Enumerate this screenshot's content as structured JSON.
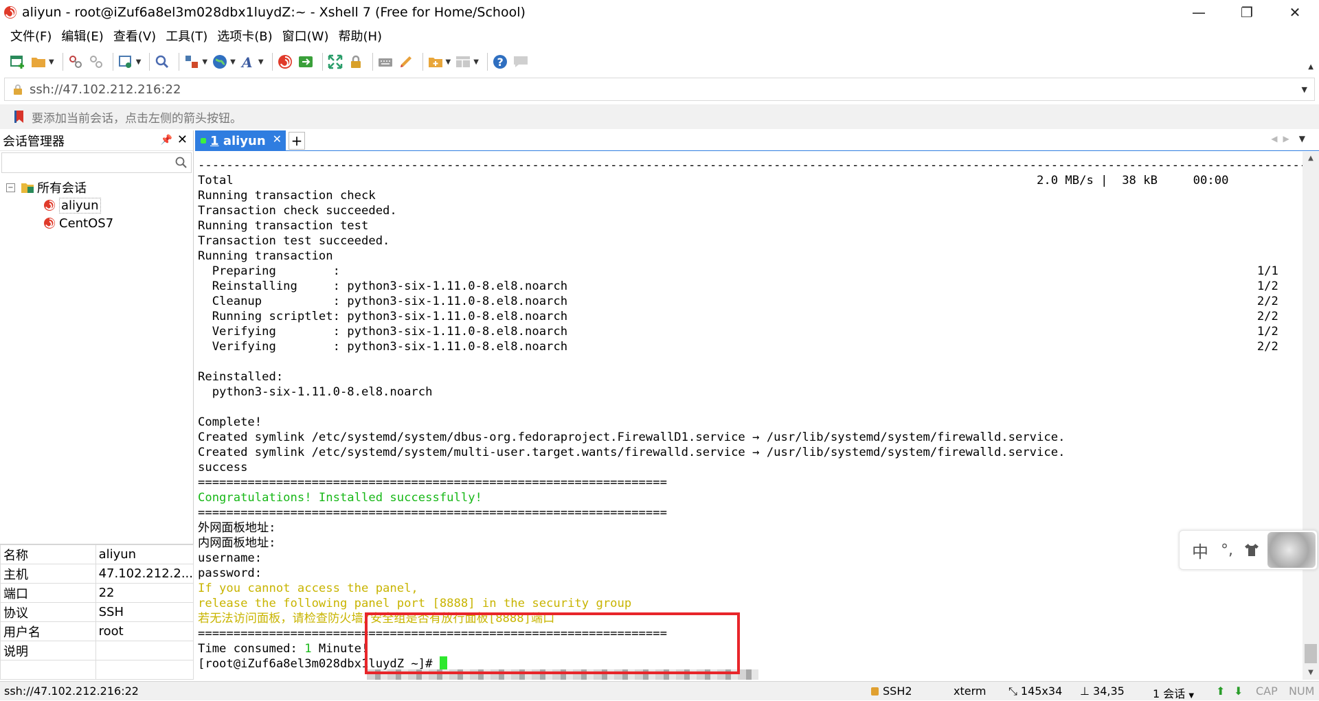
{
  "window": {
    "title": "aliyun - root@iZuf6a8el3m028dbx1luydZ:~ - Xshell 7 (Free for Home/School)",
    "controls": {
      "minimize": "—",
      "restore": "❐",
      "close": "✕"
    }
  },
  "menu": [
    "文件(F)",
    "编辑(E)",
    "查看(V)",
    "工具(T)",
    "选项卡(B)",
    "窗口(W)",
    "帮助(H)"
  ],
  "address": {
    "value": "ssh://47.102.212.216:22"
  },
  "hint": {
    "text": "要添加当前会话，点击左侧的箭头按钮。"
  },
  "session_manager": {
    "title": "会话管理器",
    "tree": {
      "root": "所有会话",
      "children": [
        "aliyun",
        "CentOS7"
      ]
    },
    "properties": [
      {
        "key": "名称",
        "value": "aliyun"
      },
      {
        "key": "主机",
        "value": "47.102.212.2..."
      },
      {
        "key": "端口",
        "value": "22"
      },
      {
        "key": "协议",
        "value": "SSH"
      },
      {
        "key": "用户名",
        "value": "root"
      },
      {
        "key": "说明",
        "value": ""
      },
      {
        "key": "",
        "value": ""
      }
    ]
  },
  "tabs": [
    {
      "num": "1",
      "label": "aliyun"
    }
  ],
  "terminal": {
    "lines": [
      {
        "t": "---------------------------------------------------------------------------------------------------------------------------------------------------------------------"
      },
      {
        "t": "Total                                                                                                                 2.0 MB/s |  38 kB     00:00"
      },
      {
        "t": "Running transaction check"
      },
      {
        "t": "Transaction check succeeded."
      },
      {
        "t": "Running transaction test"
      },
      {
        "t": "Transaction test succeeded."
      },
      {
        "t": "Running transaction"
      },
      {
        "t": "  Preparing        :                                                                                                                                 1/1"
      },
      {
        "t": "  Reinstalling     : python3-six-1.11.0-8.el8.noarch                                                                                                 1/2"
      },
      {
        "t": "  Cleanup          : python3-six-1.11.0-8.el8.noarch                                                                                                 2/2"
      },
      {
        "t": "  Running scriptlet: python3-six-1.11.0-8.el8.noarch                                                                                                 2/2"
      },
      {
        "t": "  Verifying        : python3-six-1.11.0-8.el8.noarch                                                                                                 1/2"
      },
      {
        "t": "  Verifying        : python3-six-1.11.0-8.el8.noarch                                                                                                 2/2"
      },
      {
        "t": ""
      },
      {
        "t": "Reinstalled:"
      },
      {
        "t": "  python3-six-1.11.0-8.el8.noarch"
      },
      {
        "t": ""
      },
      {
        "t": "Complete!"
      },
      {
        "t": "Created symlink /etc/systemd/system/dbus-org.fedoraproject.FirewallD1.service → /usr/lib/systemd/system/firewalld.service."
      },
      {
        "t": "Created symlink /etc/systemd/system/multi-user.target.wants/firewalld.service → /usr/lib/systemd/system/firewalld.service."
      },
      {
        "t": "success"
      },
      {
        "t": "=================================================================="
      },
      {
        "t": "Congratulations! Installed successfully!",
        "c": "g"
      },
      {
        "t": "=================================================================="
      },
      {
        "t": "外网面板地址: "
      },
      {
        "t": "内网面板地址: "
      },
      {
        "t": "username: "
      },
      {
        "t": "password: "
      },
      {
        "t": "If you cannot access the panel,",
        "c": "y"
      },
      {
        "t": "release the following panel port [8888] in the security group",
        "c": "y"
      },
      {
        "t": "若无法访问面板，请检查防火墙/安全组是否有放行面板[8888]端口",
        "c": "y"
      },
      {
        "t": "=================================================================="
      },
      {
        "t": "Time consumed: ",
        "tail": "1",
        "tailc": "g",
        "after": " Minute!"
      },
      {
        "t": "[root@iZuf6a8el3m028dbx1luydZ ~]# ",
        "cursor": true
      }
    ]
  },
  "ime": {
    "lang": "中",
    "punct": "°,"
  },
  "status": {
    "address": "ssh://47.102.212.216:22",
    "protocol": "SSH2",
    "term": "xterm",
    "size": "145x34",
    "pos": "34,35",
    "sessions": "1 会话",
    "cap": "CAP",
    "num": "NUM"
  },
  "colors": {
    "accent": "#2f7de0",
    "highlight_box": "#e8262a",
    "success_green": "#18b818",
    "warning_yellow": "#c8b400"
  }
}
